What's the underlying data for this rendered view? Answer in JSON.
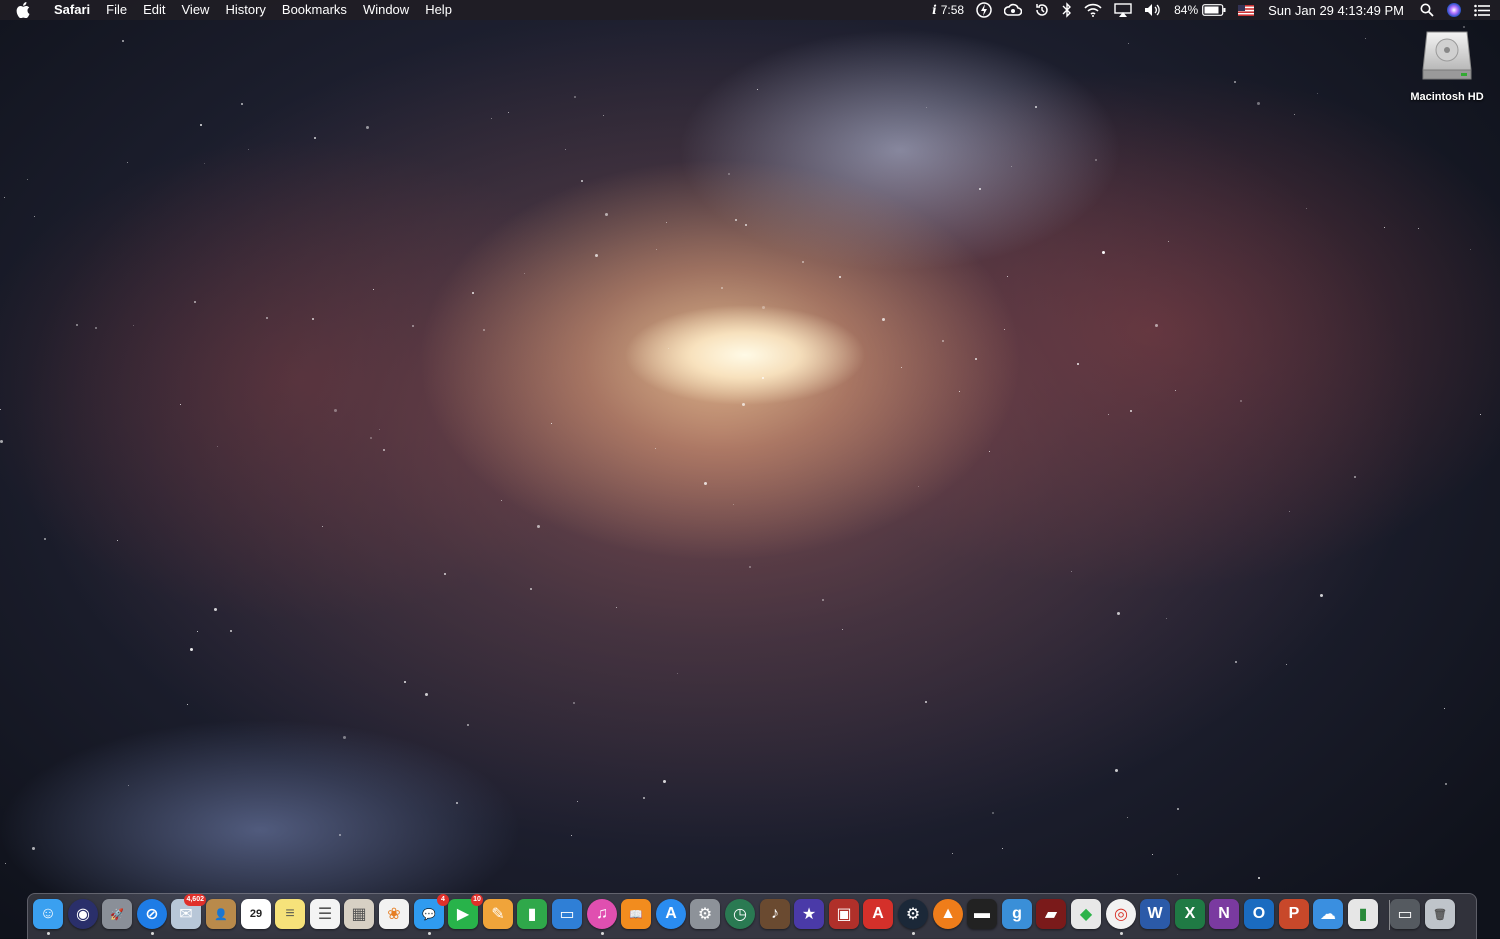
{
  "menubar": {
    "app_name": "Safari",
    "menus": [
      "File",
      "Edit",
      "View",
      "History",
      "Bookmarks",
      "Window",
      "Help"
    ],
    "status": {
      "info_time": "7:58",
      "battery_percent": "84%",
      "datetime": "Sun Jan 29  4:13:49 PM"
    }
  },
  "desktop": {
    "icons": [
      {
        "label": "Macintosh HD",
        "icon": "hard-drive-icon"
      }
    ]
  },
  "dock": {
    "apps": [
      {
        "name": "finder",
        "bg": "#3aa0f0",
        "glyph": "☺"
      },
      {
        "name": "siri",
        "bg": "#2a2f6a",
        "glyph": "◉"
      },
      {
        "name": "launchpad",
        "bg": "#8a8f98",
        "glyph": "🚀"
      },
      {
        "name": "safari",
        "bg": "#1e7ce6",
        "glyph": "⊘"
      },
      {
        "name": "mail",
        "bg": "#b8c7d8",
        "glyph": "✉",
        "badge": "4,602"
      },
      {
        "name": "contacts",
        "bg": "#b98a4b",
        "glyph": "👤"
      },
      {
        "name": "calendar",
        "bg": "#ffffff",
        "glyph": "29",
        "fg": "#222"
      },
      {
        "name": "notes",
        "bg": "#f6e27a",
        "glyph": "≡",
        "fg": "#665"
      },
      {
        "name": "reminders",
        "bg": "#f4f4f4",
        "glyph": "☰",
        "fg": "#555"
      },
      {
        "name": "preview",
        "bg": "#d7d0c4",
        "glyph": "▦",
        "fg": "#555"
      },
      {
        "name": "photos",
        "bg": "#f2f2f2",
        "glyph": "❀",
        "fg": "#e67e22"
      },
      {
        "name": "messages",
        "bg": "#2f9bf0",
        "glyph": "💬",
        "badge": "4"
      },
      {
        "name": "facetime",
        "bg": "#28b34a",
        "glyph": "▶",
        "badge": "10"
      },
      {
        "name": "pages",
        "bg": "#f0a43a",
        "glyph": "✎"
      },
      {
        "name": "numbers",
        "bg": "#2fa84a",
        "glyph": "▮"
      },
      {
        "name": "keynote",
        "bg": "#2f7fd6",
        "glyph": "▭"
      },
      {
        "name": "itunes",
        "bg": "#e04fb0",
        "glyph": "♫"
      },
      {
        "name": "ibooks",
        "bg": "#f28c1e",
        "glyph": "📖"
      },
      {
        "name": "app-store",
        "bg": "#2a8cf0",
        "glyph": "A"
      },
      {
        "name": "system-preferences",
        "bg": "#8d9299",
        "glyph": "⚙"
      },
      {
        "name": "time-machine",
        "bg": "#2a7a52",
        "glyph": "◷"
      },
      {
        "name": "instruments",
        "bg": "#6a4a30",
        "glyph": "♪"
      },
      {
        "name": "imovie",
        "bg": "#4a3aa8",
        "glyph": "★"
      },
      {
        "name": "photo-booth",
        "bg": "#b0302a",
        "glyph": "▣"
      },
      {
        "name": "adobe-acrobat",
        "bg": "#d4302a",
        "glyph": "A"
      },
      {
        "name": "steam",
        "bg": "#1b2838",
        "glyph": "⚙"
      },
      {
        "name": "vlc",
        "bg": "#ef7d1a",
        "glyph": "▲"
      },
      {
        "name": "terminal-video",
        "bg": "#222222",
        "glyph": "▬"
      },
      {
        "name": "grammarly",
        "bg": "#3a8fd8",
        "glyph": "g"
      },
      {
        "name": "truck-game",
        "bg": "#7a1a1a",
        "glyph": "▰"
      },
      {
        "name": "the-sims",
        "bg": "#e8e8e8",
        "glyph": "◆",
        "fg": "#2db34a"
      },
      {
        "name": "chrome",
        "bg": "#f2f2f2",
        "glyph": "◎",
        "fg": "#d93025"
      },
      {
        "name": "word",
        "bg": "#2b5aa8",
        "glyph": "W"
      },
      {
        "name": "excel",
        "bg": "#1f7a44",
        "glyph": "X"
      },
      {
        "name": "onenote",
        "bg": "#7a3aa0",
        "glyph": "N"
      },
      {
        "name": "outlook",
        "bg": "#1a6bc0",
        "glyph": "O"
      },
      {
        "name": "powerpoint",
        "bg": "#c8482a",
        "glyph": "P"
      },
      {
        "name": "onedrive",
        "bg": "#3a8fe0",
        "glyph": "☁"
      },
      {
        "name": "battery-app",
        "bg": "#e6e6e6",
        "glyph": "▮",
        "fg": "#2a8a3a"
      },
      {
        "name": "screen-window",
        "bg": "#555a60",
        "glyph": "▭"
      },
      {
        "name": "trash",
        "bg": "#bfc4ca",
        "glyph": "🗑",
        "fg": "#555"
      }
    ]
  }
}
